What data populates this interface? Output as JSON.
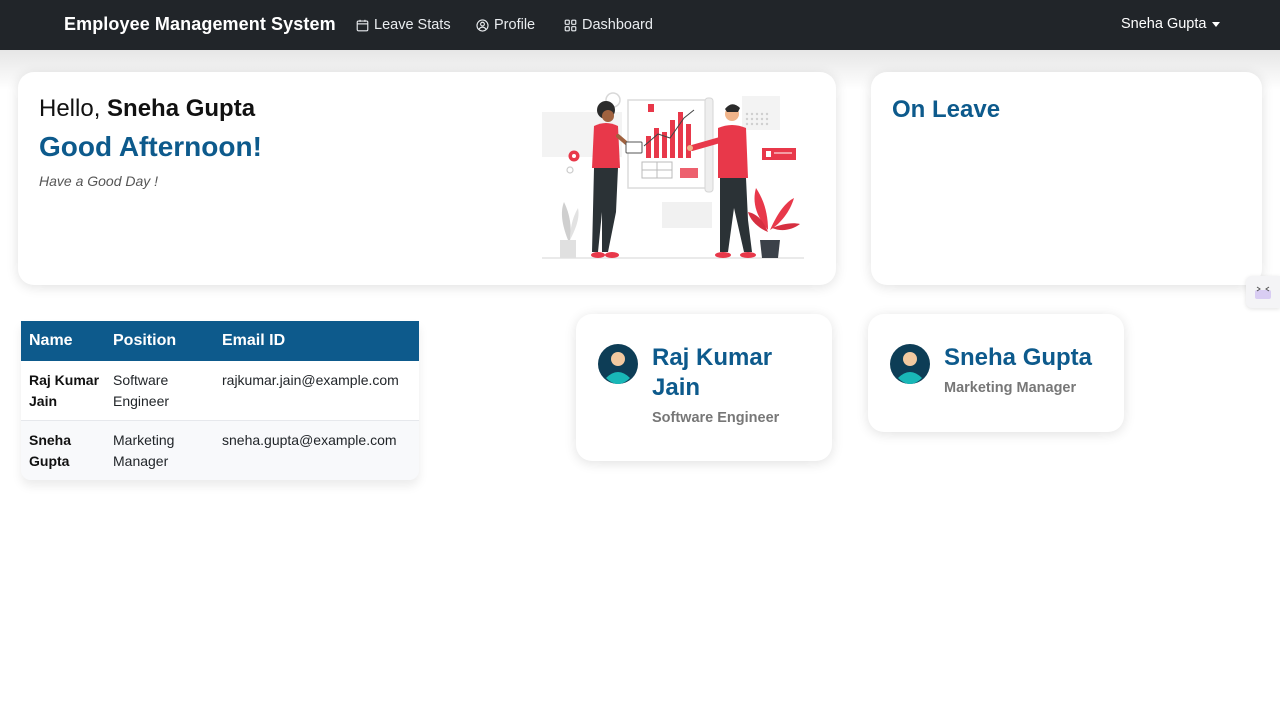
{
  "navbar": {
    "brand": "Employee Management System",
    "links": [
      {
        "label": "Leave Stats",
        "icon": "calendar-icon"
      },
      {
        "label": "Profile",
        "icon": "user-circle-icon"
      },
      {
        "label": "Dashboard",
        "icon": "grid-icon"
      }
    ],
    "user": "Sneha Gupta"
  },
  "greeting": {
    "hello": "Hello,",
    "name": "Sneha Gupta",
    "message": "Good Afternoon!",
    "sub": "Have a Good Day !"
  },
  "leave": {
    "title": "On Leave"
  },
  "table": {
    "headers": [
      "Name",
      "Position",
      "Email ID"
    ],
    "rows": [
      [
        "Raj Kumar Jain",
        "Software Engineer",
        "rajkumar.jain@example.com"
      ],
      [
        "Sneha Gupta",
        "Marketing Manager",
        "sneha.gupta@example.com"
      ]
    ]
  },
  "employees": [
    {
      "name": "Raj Kumar Jain",
      "position": "Software Engineer"
    },
    {
      "name": "Sneha Gupta",
      "position": "Marketing Manager"
    }
  ],
  "colors": {
    "navbar": "#212529",
    "accent": "#0d5a8c",
    "illustration_red": "#e8384a"
  }
}
